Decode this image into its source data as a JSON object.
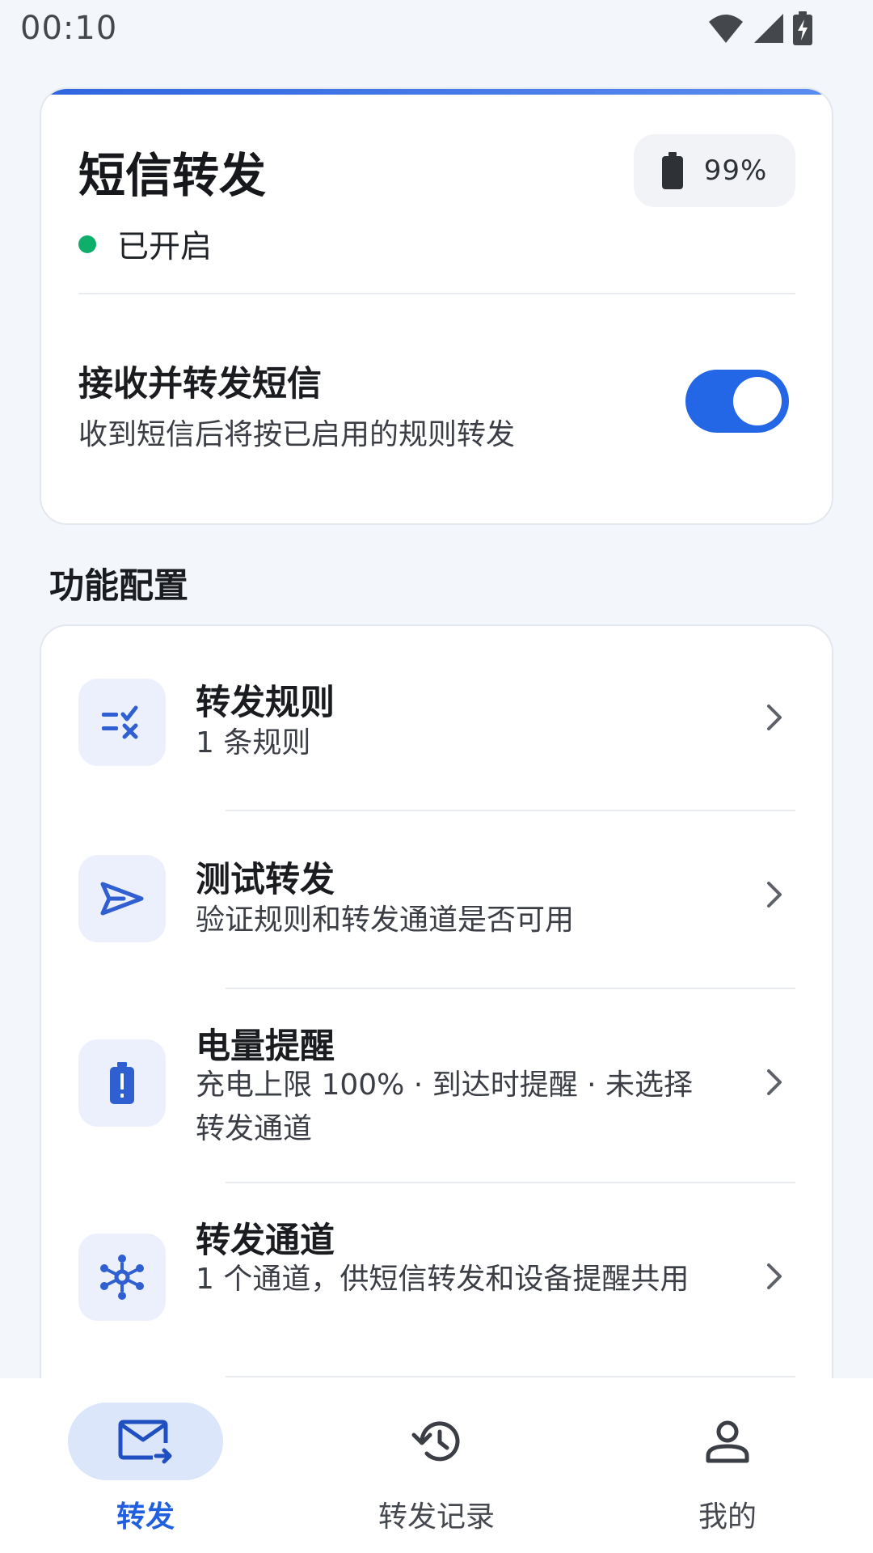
{
  "status_bar": {
    "time": "00:10"
  },
  "main_card": {
    "title": "短信转发",
    "battery_level": "99%",
    "status": "已开启",
    "toggle": {
      "title": "接收并转发短信",
      "description": "收到短信后将按已启用的规则转发",
      "enabled": true
    }
  },
  "section": {
    "title": "功能配置"
  },
  "items": [
    {
      "icon": "rule-check-icon",
      "title": "转发规则",
      "desc": "1 条规则"
    },
    {
      "icon": "send-icon",
      "title": "测试转发",
      "desc": "验证规则和转发通道是否可用"
    },
    {
      "icon": "battery-alert-icon",
      "title": "电量提醒",
      "desc": "充电上限 100% · 到达时提醒 · 未选择转发通道"
    },
    {
      "icon": "hub-icon",
      "title": "转发通道",
      "desc": "1 个通道，供短信转发和设备提醒共用"
    }
  ],
  "nav": [
    {
      "label": "转发",
      "icon": "mail-forward-icon",
      "active": true
    },
    {
      "label": "转发记录",
      "icon": "history-icon",
      "active": false
    },
    {
      "label": "我的",
      "icon": "person-icon",
      "active": false
    }
  ],
  "colors": {
    "accent": "#2467E6",
    "status_on": "#0FAE6B",
    "icon_bg": "#EBF0FC"
  }
}
